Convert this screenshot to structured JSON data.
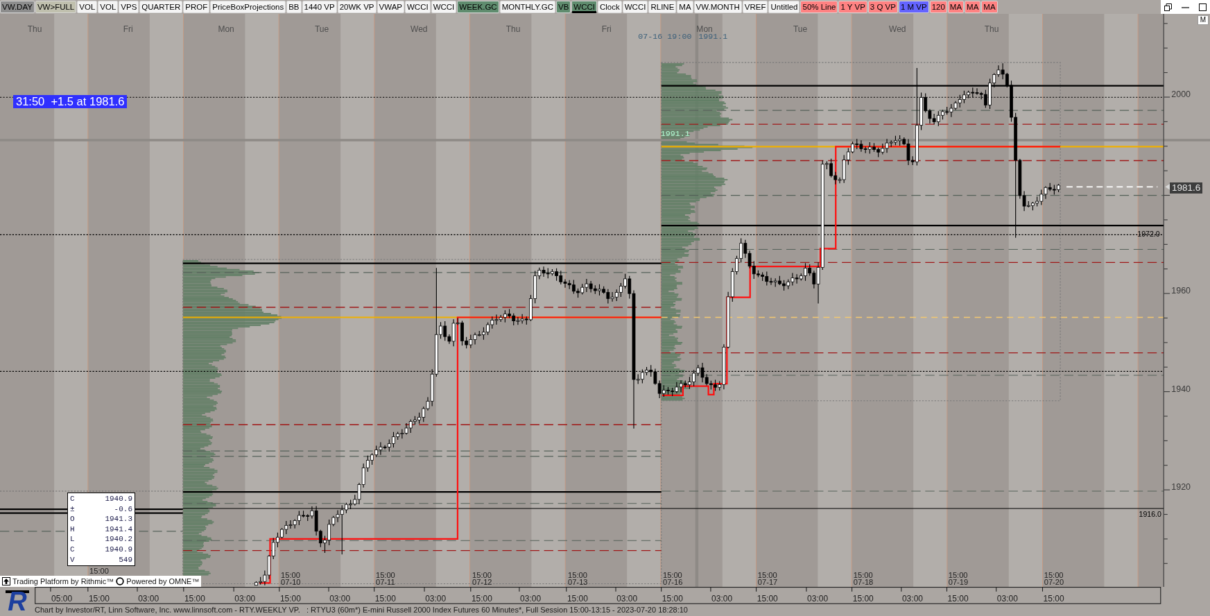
{
  "toolbar": {
    "buttons": [
      {
        "label": "VW.DAY",
        "color": "#8c8c8c",
        "selected": false
      },
      {
        "label": "VW>FULL",
        "color": "#c0c0ae",
        "selected": false
      },
      {
        "label": "VOL",
        "color": "#f4f4f4",
        "selected": false
      },
      {
        "label": "VOL",
        "color": "#f4f4f4",
        "selected": false
      },
      {
        "label": "VPS",
        "color": "#f4f4f4",
        "selected": false
      },
      {
        "label": "QUARTER",
        "color": "#f4f4f4",
        "selected": false
      },
      {
        "label": "PROF",
        "color": "#f4f4f4",
        "selected": false
      },
      {
        "label": "PriceBoxProjections",
        "color": "#f4f4f4",
        "selected": false
      },
      {
        "label": "BB",
        "color": "#f4f4f4",
        "selected": false
      },
      {
        "label": "1440 VP",
        "color": "#f4f4f4",
        "selected": false
      },
      {
        "label": "20WK VP",
        "color": "#f4f4f4",
        "selected": false
      },
      {
        "label": "VWAP",
        "color": "#f4f4f4",
        "selected": false
      },
      {
        "label": "WCCI",
        "color": "#f4f4f4",
        "selected": false
      },
      {
        "label": "WCCI",
        "color": "#f4f4f4",
        "selected": false
      },
      {
        "label": "WEEK.GC",
        "color": "#5f8c6e",
        "selected": false
      },
      {
        "label": "MONTHLY.GC",
        "color": "#f4f4f4",
        "selected": false
      },
      {
        "label": "VB",
        "color": "#5f8c6e",
        "selected": false
      },
      {
        "label": "WCCI",
        "color": "#5f8c6e",
        "selected": true
      },
      {
        "label": "Clock",
        "color": "#f4f4f4",
        "selected": false
      },
      {
        "label": "WCCI",
        "color": "#f4f4f4",
        "selected": false
      },
      {
        "label": "RLINE",
        "color": "#f4f4f4",
        "selected": false
      },
      {
        "label": "MA",
        "color": "#f4f4f4",
        "selected": false
      },
      {
        "label": "VW.MONTH",
        "color": "#f4f4f4",
        "selected": false
      },
      {
        "label": "VREF",
        "color": "#f4f4f4",
        "selected": false
      },
      {
        "label": "Untitled",
        "color": "#f4f4f4",
        "selected": false
      },
      {
        "label": "50% Line",
        "color": "#ff8282",
        "selected": false
      },
      {
        "label": "1 Y VP",
        "color": "#ff8282",
        "selected": false
      },
      {
        "label": "3 Q VP",
        "color": "#ff8282",
        "selected": false
      },
      {
        "label": "1 M VP",
        "color": "#6464ff",
        "selected": false
      },
      {
        "label": "120",
        "color": "#ff8282",
        "selected": false
      },
      {
        "label": "MA",
        "color": "#ff8282",
        "selected": false
      },
      {
        "label": "MA",
        "color": "#ff8282",
        "selected": false
      },
      {
        "label": "MA",
        "color": "#ff8282",
        "selected": false
      }
    ]
  },
  "chart": {
    "day_labels": [
      "Thu",
      "Fri",
      "Mon",
      "Tue",
      "Wed",
      "Thu",
      "Fri",
      "Mon",
      "Tue",
      "Wed",
      "Thu"
    ],
    "crosshair_readout": {
      "time": "07-16 19:00",
      "price": "1991.1"
    },
    "profile_label": "1991.1",
    "countdown_badge": "31:50  +1.5 at 1981.6",
    "level_labels": [
      "1972.0",
      "1916.0"
    ],
    "ohlc_panel": [
      {
        "label": "C",
        "value": "1940.9"
      },
      {
        "label": "±",
        "value": "-0.6"
      },
      {
        "label": "O",
        "value": "1941.3"
      },
      {
        "label": "H",
        "value": "1941.4"
      },
      {
        "label": "L",
        "value": "1940.2"
      },
      {
        "label": "C",
        "value": "1940.9"
      },
      {
        "label": "V",
        "value": "549"
      }
    ],
    "session_labels": [
      {
        "time": "15:00"
      },
      {
        "time": "15:00",
        "date": "07-10"
      },
      {
        "time": "15:00",
        "date": "07-11"
      },
      {
        "time": "15:00",
        "date": "07-12"
      },
      {
        "time": "15:00",
        "date": "07-13"
      },
      {
        "time": "15:00",
        "date": "07-16"
      },
      {
        "time": "15:00",
        "date": "07-17"
      },
      {
        "time": "15:00",
        "date": "07-18"
      },
      {
        "time": "15:00",
        "date": "07-19"
      },
      {
        "time": "15:00",
        "date": "07-20"
      }
    ],
    "price_axis": {
      "labels": [
        "2000",
        "1960",
        "1940",
        "1920"
      ],
      "last_price": "1981.6"
    },
    "scale_button": "M",
    "branding": {
      "platform": "Trading Platform by Rithmic™",
      "powered": "Powered by OMNE™"
    }
  },
  "time_axis": {
    "labels": [
      "05:00",
      "15:00",
      "03:00",
      "15:00",
      "03:00",
      "15:00",
      "03:00",
      "15:00",
      "03:00",
      "15:00",
      "03:00",
      "15:00",
      "03:00",
      "15:00",
      "03:00",
      "15:00",
      "03:00",
      "15:00",
      "03:00",
      "15:00",
      "03:00",
      "15:00"
    ]
  },
  "logo": "R",
  "status_bar": "Chart by Investor/RT, Linn Software, Inc. www.linnsoft.com - RTY.WEEKLY VP.   : RTYU3 (60m*) E-mini Russell 2000 Index Futures 60 Minutes*, Full Session 15:00-13:15 - 2023-07-20 18:28:10"
}
